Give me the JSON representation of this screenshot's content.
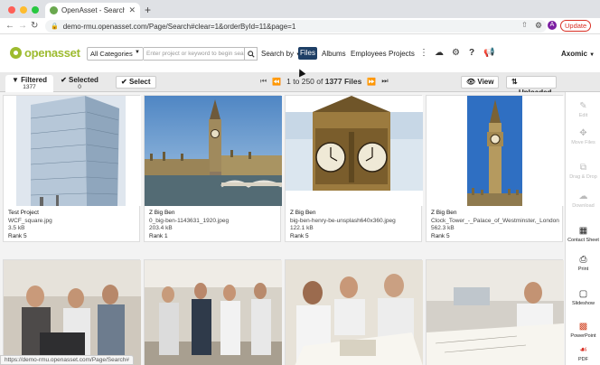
{
  "browser": {
    "tab_title": "OpenAsset - Search Results",
    "tab_close": "✕",
    "new_tab": "+",
    "url": "demo-rmu.openasset.com/Page/Search#clear=1&orderById=11&page=1",
    "avatar_letter": "A",
    "update_label": "Update",
    "status_url": "https://demo-rmu.openasset.com/Page/Search#"
  },
  "header": {
    "logo_text": "openasset",
    "category_select": "All Categories",
    "search_placeholder": "Enter project or keyword to begin searching",
    "search_by": "Search by",
    "nav": [
      "Files",
      "Albums",
      "Employees",
      "Projects"
    ],
    "brand": "Axomic"
  },
  "toolbar": {
    "filtered_label": "Filtered",
    "filtered_count": "1377",
    "selected_label": "Selected",
    "selected_count": "0",
    "select_btn": "Select",
    "pager_prefix": "1 to 250 of",
    "pager_total": "1377 Files",
    "view_btn": "View",
    "sort_btn": "Uploaded"
  },
  "files": [
    {
      "project": "Test Project",
      "filename": "WCF_square.jpg",
      "size": "3.5 kB",
      "rank": "Rank 5"
    },
    {
      "project": "Z Big Ben",
      "filename": "0_big-ben-1143631_1920.jpeg",
      "size": "203.4 kB",
      "rank": "Rank 1"
    },
    {
      "project": "Z Big Ben",
      "filename": "big-ben-henry-be-unsplash640x360.jpeg",
      "size": "122.1 kB",
      "rank": "Rank 5"
    },
    {
      "project": "Z Big Ben",
      "filename": "Clock_Tower_-_Palace_of_Westminster,_London_-_May_2007.jpg",
      "size": "562.3 kB",
      "rank": "Rank 5"
    }
  ],
  "sidebar": {
    "items": [
      {
        "label": "Edit",
        "icon": "pencil-icon",
        "enabled": false
      },
      {
        "label": "Move Files",
        "icon": "move-icon",
        "enabled": false
      },
      {
        "label": "Drag & Drop",
        "icon": "drag-icon",
        "enabled": false
      },
      {
        "label": "Download",
        "icon": "cloud-download-icon",
        "enabled": false
      },
      {
        "label": "Contact Sheet",
        "icon": "grid-icon",
        "enabled": true
      },
      {
        "label": "Print",
        "icon": "printer-icon",
        "enabled": true
      },
      {
        "label": "Slideshow",
        "icon": "monitor-icon",
        "enabled": true
      },
      {
        "label": "PowerPoint",
        "icon": "powerpoint-icon",
        "enabled": true
      },
      {
        "label": "PDF",
        "icon": "pdf-icon",
        "enabled": true
      }
    ]
  },
  "colors": {
    "brand_green": "#9dbb2f",
    "files_active": "#1e3f66",
    "update_red": "#d93025"
  }
}
